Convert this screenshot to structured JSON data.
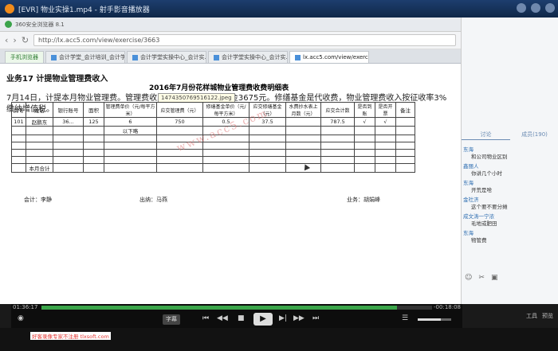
{
  "player": {
    "title": "[EVR] 物业实操1.mp4 - 射手影音播放器",
    "time_current": "01:36:17",
    "time_remaining": "-00:18:08",
    "progress_fraction": 0.91,
    "volume_fraction": 0.7,
    "speed_label": "字幕",
    "play_icon": "play-icon"
  },
  "browser": {
    "title": "360安全浏览器 8.1",
    "url": "http://lx.acc5.com/view/exercise/3663",
    "tabs": [
      {
        "label": "手机浏览器"
      },
      {
        "label": "会计学堂_会计培训_会计学..."
      },
      {
        "label": "会计学堂实操中心_会计实..."
      },
      {
        "label": "会计学堂实操中心_会计实..."
      },
      {
        "label": "lx.acc5.com/view/exercise/..."
      }
    ]
  },
  "page": {
    "business_title": "业务17  计提物业管理费收入",
    "description": "7月14日，计提本月物业管理费。管理费收入57000元，修缮基金3675元。修缮基金是代收费，物业管理费收入按征收率3%缴纳增值税。",
    "table_title": "2016年7月份花样城物业管理费收费明细表",
    "tooltip": "1474350769516122.jpeg",
    "watermark": "www.acc5.com"
  },
  "ledger": {
    "headers_top": [
      "房号",
      "姓名",
      "银行账号",
      "面积",
      "管理费单价（元/每平方米）",
      "应交管理费（元）",
      "修缮基金单价（元/每平方米）",
      "应交修缮基金（元）",
      "水费抄水表上月数（元）",
      "应交合计数",
      "是否到账",
      "是否开票",
      "备注"
    ],
    "row1": [
      "101",
      "赵鹏东",
      "36...",
      "125",
      "6",
      "750",
      "0.5",
      "37.5",
      "",
      "787.5",
      "√",
      "√",
      ""
    ],
    "below_note": "以下略",
    "total_label": "本月合计"
  },
  "signatures": {
    "accountant": "会计：李静",
    "cashier": "出纳：马燕",
    "business": "业务：胡娟峰"
  },
  "side": {
    "tabs": [
      "讨论",
      "成员(190)"
    ],
    "messages": [
      {
        "user": "东海",
        "text": "和公司物业区别"
      },
      {
        "user": "鑫丽人",
        "text": "你讲几个小时"
      },
      {
        "user": "东海",
        "text": "开荒是啥"
      },
      {
        "user": "金社济",
        "text": "这个要不要分摊"
      },
      {
        "user": "成文涛一宁浓",
        "text": "毛地或肥田"
      },
      {
        "user": "东海",
        "text": "物管费"
      }
    ]
  },
  "bottom": {
    "ad_text": "好客录像专家不注册 tlxsoft.com",
    "tools_label": "工具",
    "extra_label": "预览"
  }
}
